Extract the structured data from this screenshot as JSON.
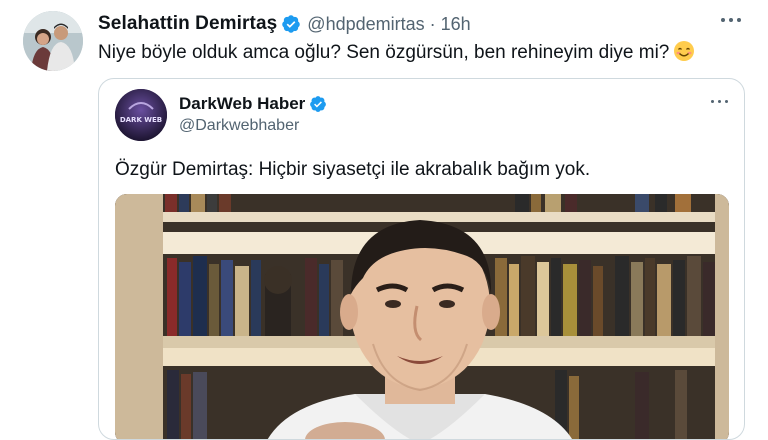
{
  "tweet": {
    "author_name": "Selahattin Demirtaş",
    "handle": "@hdpdemirtas",
    "separator": "·",
    "time": "16h",
    "text": "Niye böyle olduk amca oğlu? Sen özgürsün, ben rehineyim diye mi?",
    "emoji": "smiling-face-emoji"
  },
  "quoted": {
    "author_name": "DarkWeb Haber",
    "handle": "@Darkwebhaber",
    "text": "Özgür Demirtaş: Hiçbir siyasetçi ile akrabalık bağım yok.",
    "avatar_text": "DARK WEB"
  },
  "colors": {
    "verified": "#1d9bf0",
    "secondary_text": "#536471",
    "border": "#cfd9de"
  }
}
